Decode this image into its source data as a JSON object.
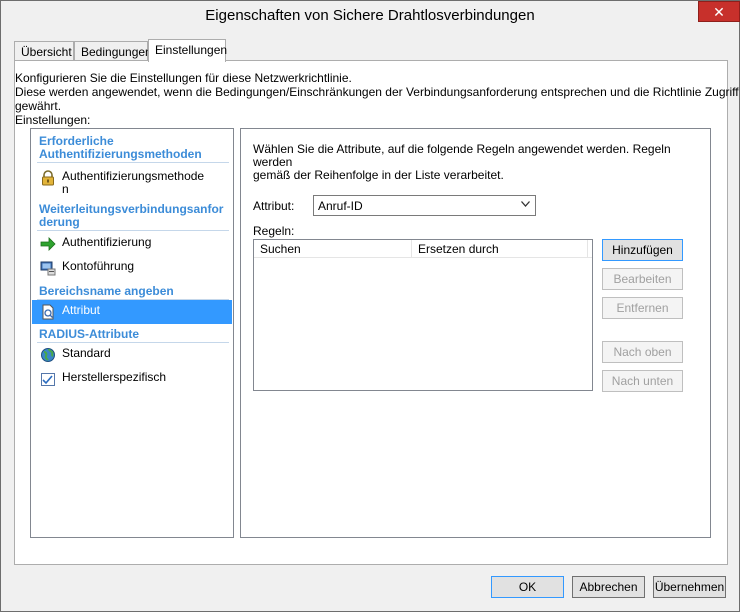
{
  "window": {
    "title": "Eigenschaften von Sichere Drahtlosverbindungen",
    "close": "✕"
  },
  "tabs": [
    {
      "label": "Übersicht"
    },
    {
      "label": "Bedingungen"
    },
    {
      "label": "Einstellungen"
    }
  ],
  "description": {
    "line1": "Konfigurieren Sie die Einstellungen für diese Netzwerkrichtlinie.",
    "line2": "Diese werden angewendet, wenn die Bedingungen/Einschränkungen der Verbindungsanforderung entsprechen und die Richtlinie Zugriff gewährt."
  },
  "settings_label": "Einstellungen:",
  "nav": {
    "group1": {
      "line1": "Erforderliche",
      "line2": "Authentifizierungsmethoden"
    },
    "item1": {
      "line1": "Authentifizierungsmethode",
      "line2": "n",
      "icon": "lock-icon"
    },
    "group2": {
      "line1": "Weiterleitungsverbindungsanfor",
      "line2": "derung"
    },
    "item2": {
      "label": "Authentifizierung",
      "icon": "green-arrow-icon"
    },
    "item3": {
      "label": "Kontoführung",
      "icon": "computer-icon"
    },
    "group3": {
      "label": "Bereichsname angeben"
    },
    "item4": {
      "label": "Attribut",
      "icon": "attribute-icon"
    },
    "group4": {
      "label": "RADIUS-Attribute"
    },
    "item5": {
      "label": "Standard",
      "icon": "globe-icon"
    },
    "item6": {
      "label": "Herstellerspezifisch",
      "icon": "checklist-icon"
    }
  },
  "content": {
    "intro_line1": "Wählen Sie die Attribute, auf die folgende Regeln angewendet werden. Regeln werden",
    "intro_line2": "gemäß der Reihenfolge in der Liste verarbeitet.",
    "attribute_label": "Attribut:",
    "attribute_value": "Anruf-ID",
    "rules_label": "Regeln:",
    "columns": [
      "Suchen",
      "Ersetzen durch"
    ],
    "buttons": {
      "add": "Hinzufügen",
      "edit": "Bearbeiten",
      "remove": "Entfernen",
      "up": "Nach oben",
      "down": "Nach unten"
    }
  },
  "footer": {
    "ok": "OK",
    "cancel": "Abbrechen",
    "apply": "Übernehmen"
  },
  "colors": {
    "group_heading": "#3c8cd8",
    "selection": "#3399ff",
    "close_button": "#c7302b"
  }
}
